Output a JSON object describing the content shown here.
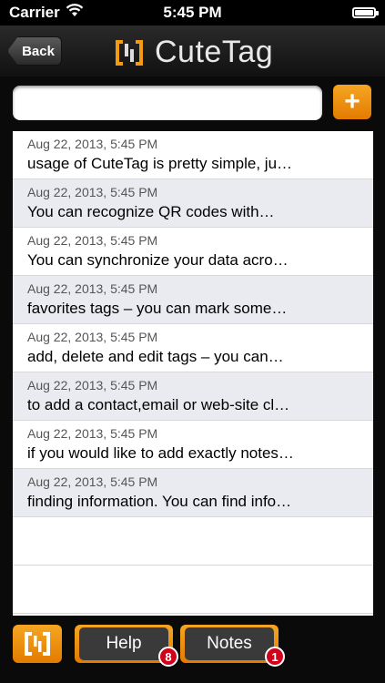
{
  "status_bar": {
    "carrier": "Carrier",
    "time": "5:45 PM"
  },
  "nav": {
    "back_label": "Back",
    "app_title": "CuteTag"
  },
  "search": {
    "placeholder": "",
    "add_label": "+"
  },
  "items": [
    {
      "date": "Aug 22, 2013, 5:45 PM",
      "text": "usage of CuteTag is pretty simple, ju…"
    },
    {
      "date": "Aug 22, 2013, 5:45 PM",
      "text": "You can recognize QR codes with…"
    },
    {
      "date": "Aug 22, 2013, 5:45 PM",
      "text": "You can synchronize your data acro…"
    },
    {
      "date": "Aug 22, 2013, 5:45 PM",
      "text": "favorites tags – you can mark some…"
    },
    {
      "date": "Aug 22, 2013, 5:45 PM",
      "text": "add, delete and edit tags – you can…"
    },
    {
      "date": "Aug 22, 2013, 5:45 PM",
      "text": "to add a  contact,email or web-site cl…"
    },
    {
      "date": "Aug 22, 2013, 5:45 PM",
      "text": "if you would like to add exactly notes…"
    },
    {
      "date": "Aug 22, 2013, 5:45 PM",
      "text": "finding information. You can find info…"
    }
  ],
  "toolbar": {
    "help_label": "Help",
    "help_badge": "8",
    "notes_label": "Notes",
    "notes_badge": "1"
  },
  "colors": {
    "accent": "#f39c12",
    "badge": "#d0021b"
  }
}
